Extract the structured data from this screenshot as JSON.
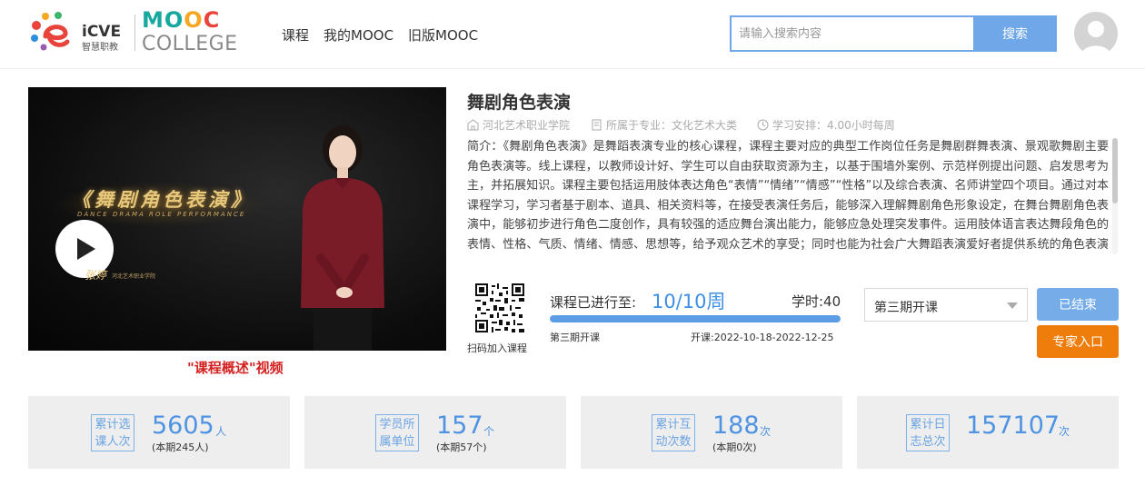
{
  "header": {
    "logo_icve_text": "iCVE",
    "logo_icve_sub": "智慧职教",
    "logo_mooc_text": "MOOC",
    "logo_college_text": "COLLEGE",
    "nav": [
      "课程",
      "我的MOOC",
      "旧版MOOC"
    ],
    "search_placeholder": "请输入搜索内容",
    "search_button": "搜索"
  },
  "video": {
    "title_art": "《舞剧角色表演》",
    "subtitle_art": "DANCE DRAMA ROLE PERFORMANCE",
    "presenter_name": "张婷",
    "presenter_school": "河北艺术职业学院",
    "caption": "\"课程概述\"视频"
  },
  "course": {
    "title": "舞剧角色表演",
    "school": "河北艺术职业学院",
    "major": "所属于专业：文化艺术大类",
    "schedule": "学习安排：4.00小时每周",
    "intro": "简介：《舞剧角色表演》是舞蹈表演专业的核心课程，课程主要对应的典型工作岗位任务是舞剧群舞表演、景观歌舞剧主要角色表演等。线上课程，以教师设计好、学生可以自由获取资源为主，以基于围墙外案例、示范样例提出问题、启发思考为主，并拓展知识。课程主要包括运用肢体表达角色“表情”“情绪”“情感”“性格”以及综合表演、名师讲堂四个项目。通过对本课程学习，学习者基于剧本、道具、相关资料等，在接受表演任务后，能够深入理解舞剧角色形象设定，在舞台舞剧角色表演中，能够初步进行角色二度创作，具有较强的适应舞台演出能力，能够应急处理突发事件。运用肢体语言表达舞段角色的表情、性格、气质、情绪、情感、思想等，给予观众艺术的享受；同时也能为社会广大舞蹈表演爱好者提供系统的角色表演课程学习。"
  },
  "enroll": {
    "qr_label": "扫码加入课程",
    "progress_label": "课程已进行至:",
    "progress_value": "10/10周",
    "progress_fraction": 1.0,
    "hours": "学时:40",
    "term": "第三期开课",
    "dates": "开课:2022-10-18-2022-12-25",
    "select_value": "第三期开课",
    "btn_ended": "已结束",
    "btn_expert": "专家入口"
  },
  "stats": [
    {
      "label_1": "累计选",
      "label_2": "课人次",
      "value": "5605",
      "unit": "人",
      "sub": "(本期245人)"
    },
    {
      "label_1": "学员所",
      "label_2": "属单位",
      "value": "157",
      "unit": "个",
      "sub": "(本期57个)"
    },
    {
      "label_1": "累计互",
      "label_2": "动次数",
      "value": "188",
      "unit": "次",
      "sub": "(本期0次)"
    },
    {
      "label_1": "累计日",
      "label_2": "志总次",
      "value": "157107",
      "unit": "次",
      "sub": ""
    }
  ],
  "colors": {
    "accent_blue": "#4f93e3",
    "expert_orange": "#ef7d0b",
    "caption_red": "#d32121"
  }
}
